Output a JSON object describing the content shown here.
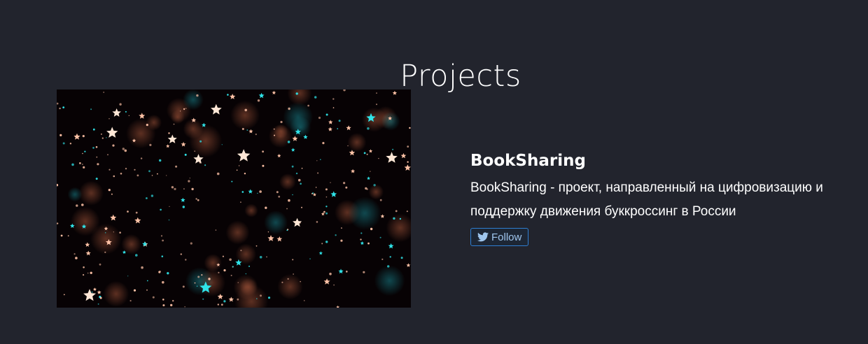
{
  "section": {
    "title": "Projects"
  },
  "project": {
    "name": "BookSharing",
    "description_line1": "BookSharing - проект, направленный на цифровизацию и",
    "description_line2": "поддержку движения буккроссинг в России",
    "image_icon": "starry-sky-image",
    "follow_button": {
      "label": "Follow",
      "icon": "twitter-bird-icon",
      "color": "#2f7fd2"
    }
  },
  "colors": {
    "background": "#22242d",
    "image_background": "#070204",
    "star_warm": "#ffc2a6",
    "star_cyan": "#2fe3e8"
  }
}
